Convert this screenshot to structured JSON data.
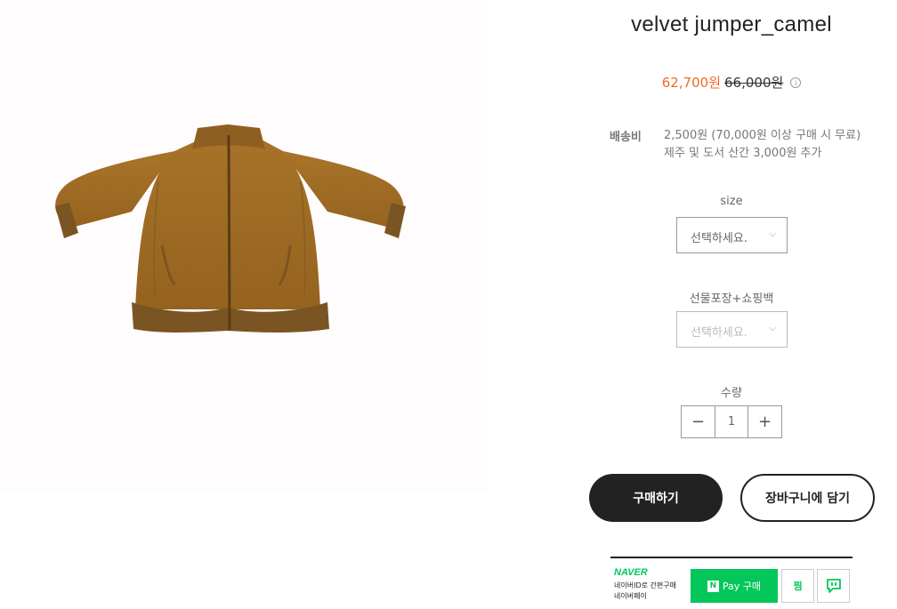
{
  "product": {
    "title": "velvet jumper_camel",
    "price_sale": "62,700원",
    "price_original": "66,000원"
  },
  "shipping": {
    "label": "배송비",
    "line1": "2,500원 (70,000원 이상 구매 시 무료)",
    "line2": "제주 및 도서 산간 3,000원 추가"
  },
  "options": {
    "size_label": "size",
    "size_value": "선택하세요.",
    "gift_label": "선물포장+쇼핑백",
    "gift_value": "선택하세요."
  },
  "quantity": {
    "label": "수량",
    "value": "1",
    "minus": "−",
    "plus": "+"
  },
  "actions": {
    "buy": "구매하기",
    "cart": "장바구니에 담기"
  },
  "naver_pay": {
    "brand": "NAVER",
    "desc_line1": "네이버ID로 간편구매",
    "desc_line2": "네이버페이",
    "pay_badge": "N",
    "pay_label": "Pay 구매",
    "zzim_label": "찜"
  },
  "colors": {
    "sale": "#f06a23",
    "naver_green": "#03c75a",
    "dark": "#222222"
  },
  "icons": [
    "info-icon",
    "chevron-down-icon",
    "talk-icon"
  ]
}
